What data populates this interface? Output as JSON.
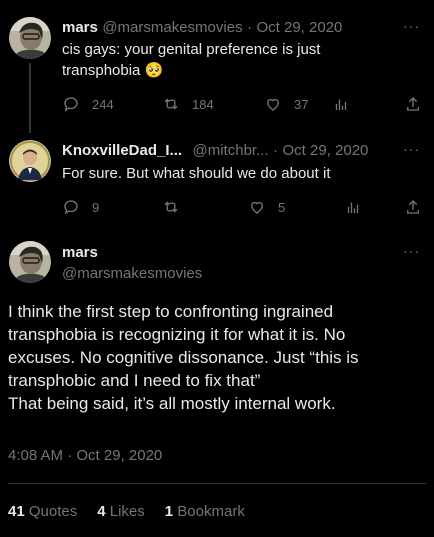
{
  "tweets": [
    {
      "name": "mars",
      "handle": "@marsmakesmovies",
      "date": "Oct 29, 2020",
      "text_line1": "cis gays: your genital preference is just",
      "text_line2": "transphobia",
      "emoji": "🥺",
      "replies": "244",
      "retweets": "184",
      "likes": "37"
    },
    {
      "name": "KnoxvilleDad_I...",
      "handle": "@mitchbr...",
      "date": "Oct 29, 2020",
      "text": "For sure. But what should we do about it",
      "replies": "9",
      "retweets": "",
      "likes": "5"
    }
  ],
  "main": {
    "name": "mars",
    "handle": "@marsmakesmovies",
    "body_lines": [
      "I think the first step to confronting ingrained",
      "transphobia is recognizing it for what it is. No",
      "excuses. No cognitive dissonance. Just “this is",
      "transphobic and I need to fix that”",
      "That being said, it’s all mostly internal work."
    ],
    "timestamp": "4:08 AM · Oct 29, 2020",
    "stats": {
      "quotes_count": "41",
      "quotes_label": "Quotes",
      "likes_count": "4",
      "likes_label": "Likes",
      "bookmarks_count": "1",
      "bookmarks_label": "Bookmark"
    }
  },
  "ui": {
    "dot": "·",
    "more": "···"
  },
  "colors": {
    "background": "#000000",
    "text_primary": "#e7e9ea",
    "text_secondary": "#71767b",
    "divider": "#2f3336"
  }
}
